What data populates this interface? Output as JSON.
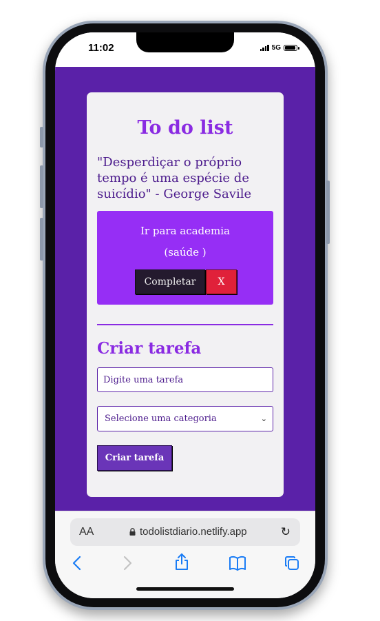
{
  "status_bar": {
    "time": "11:02",
    "network": "5G"
  },
  "app": {
    "title": "To do list",
    "quote": "\"Desperdiçar o próprio tempo é uma espécie de suicídio\" - George Savile",
    "task": {
      "name": "Ir para academia",
      "category": "(saúde )",
      "complete_label": "Completar",
      "remove_label": "X"
    },
    "form": {
      "heading": "Criar tarefa",
      "input_placeholder": "Digite uma tarefa",
      "select_value": "Selecione uma categoria",
      "submit_label": "Criar tarefa"
    }
  },
  "browser": {
    "text_size_label": "AA",
    "url": "todolistdiario.netlify.app",
    "toolbar_icons": [
      "back-icon",
      "forward-icon",
      "share-icon",
      "bookmarks-icon",
      "tabs-icon"
    ]
  },
  "colors": {
    "background": "#5a21a8",
    "accent": "#8a2be2",
    "task_card": "#962ef5",
    "remove_button": "#e0213a",
    "complete_button": "#241a2e"
  }
}
